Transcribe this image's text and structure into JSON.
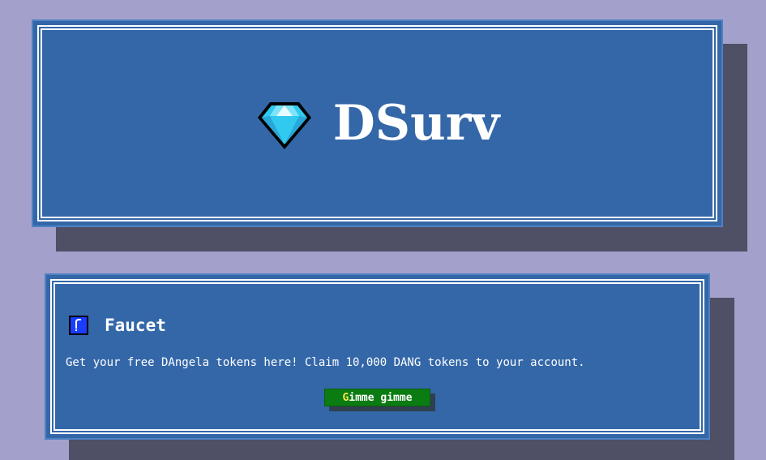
{
  "header": {
    "title": "DSurv",
    "logo_icon": "diamond-icon"
  },
  "faucet": {
    "icon": "faucet-icon",
    "title": "Faucet",
    "description": "Get your free DAngela tokens here! Claim 10,000 DANG tokens to your account.",
    "button_label_first": "G",
    "button_label_rest": "imme gimme"
  },
  "colors": {
    "background": "#a3a1cc",
    "panel": "#3467a8",
    "shadow": "#4f4f66",
    "button": "#0a7c12",
    "button_accent": "#f6e84a"
  }
}
